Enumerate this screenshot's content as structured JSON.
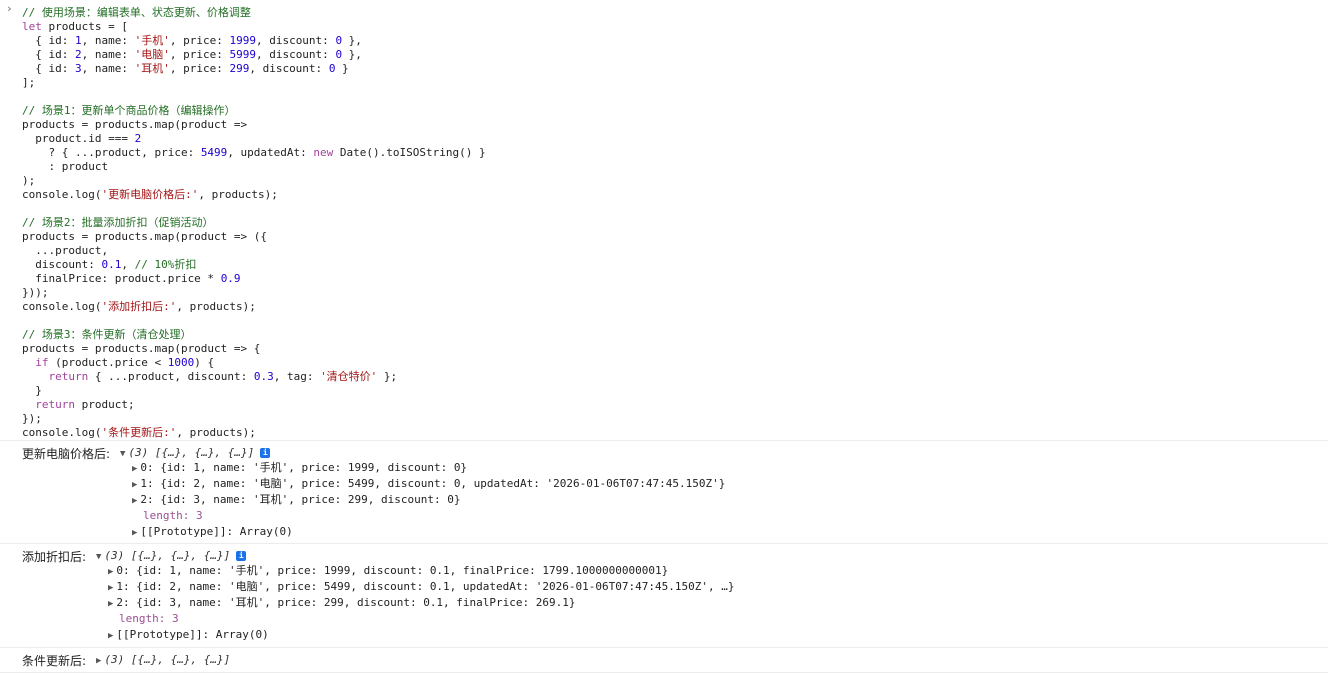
{
  "input": {
    "lines": [
      "// 使用场景：编辑表单、状态更新、价格调整",
      "let products = [",
      "  { id: 1, name: '手机', price: 1999, discount: 0 },",
      "  { id: 2, name: '电脑', price: 5999, discount: 0 },",
      "  { id: 3, name: '耳机', price: 299, discount: 0 }",
      "];",
      "",
      "// 场景1：更新单个商品价格（编辑操作）",
      "products = products.map(product =>",
      "  product.id === 2",
      "    ? { ...product, price: 5499, updatedAt: new Date().toISOString() }",
      "    : product",
      ");",
      "console.log('更新电脑价格后:', products);",
      "",
      "// 场景2：批量添加折扣（促销活动）",
      "products = products.map(product => ({",
      "  ...product,",
      "  discount: 0.1, // 10%折扣",
      "  finalPrice: product.price * 0.9",
      "}));",
      "console.log('添加折扣后:', products);",
      "",
      "// 场景3：条件更新（清仓处理）",
      "products = products.map(product => {",
      "  if (product.price < 1000) {",
      "    return { ...product, discount: 0.3, tag: '清仓特价' };",
      "  }",
      "  return product;",
      "});",
      "console.log('条件更新后:', products);"
    ]
  },
  "log1": {
    "label": "更新电脑价格后:",
    "summary": "(3) [{…}, {…}, {…}]",
    "items": [
      "0: {id: 1, name: '手机', price: 1999, discount: 0}",
      "1: {id: 2, name: '电脑', price: 5499, discount: 0, updatedAt: '2026-01-06T07:47:45.150Z'}",
      "2: {id: 3, name: '耳机', price: 299, discount: 0}"
    ],
    "length": "length: 3",
    "proto": "[[Prototype]]: Array(0)"
  },
  "log2": {
    "label": "添加折扣后:",
    "summary": "(3) [{…}, {…}, {…}]",
    "items": [
      "0: {id: 1, name: '手机', price: 1999, discount: 0.1, finalPrice: 1799.1000000000001}",
      "1: {id: 2, name: '电脑', price: 5499, discount: 0.1, updatedAt: '2026-01-06T07:47:45.150Z', …}",
      "2: {id: 3, name: '耳机', price: 299, discount: 0.1, finalPrice: 269.1}"
    ],
    "length": "length: 3",
    "proto": "[[Prototype]]: Array(0)"
  },
  "log3": {
    "label": "条件更新后:",
    "summary": "(3) [{…}, {…}, {…}]"
  },
  "icons": {
    "info": "info-icon",
    "expand": "triangle-right-icon",
    "collapse": "triangle-down-icon",
    "prompt": "chevron-right-icon"
  }
}
